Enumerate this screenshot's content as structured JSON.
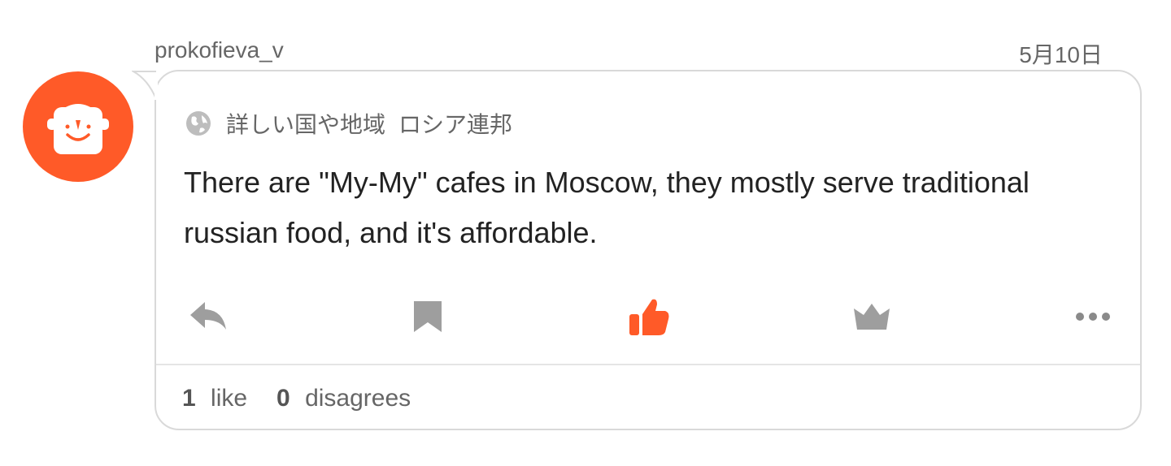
{
  "post": {
    "username": "prokofieva_v",
    "date": "5月10日",
    "region_label": "詳しい国や地域",
    "region_value": "ロシア連邦",
    "body": "There are \"My-My\" cafes in Moscow, they mostly serve traditional russian food, and it's affordable.",
    "likes_count": "1",
    "likes_label": "like",
    "disagrees_count": "0",
    "disagrees_label": "disagrees"
  },
  "icons": {
    "avatar": "robot-face-avatar",
    "region": "globe-icon",
    "reply": "reply-icon",
    "bookmark": "bookmark-icon",
    "like": "thumbs-up-icon",
    "award": "crown-icon",
    "more": "more-icon"
  },
  "colors": {
    "accent": "#ff5a28",
    "icon_gray": "#9e9e9e",
    "text_gray": "#666666",
    "text_dark": "#222222",
    "border": "#d9d9d9"
  }
}
